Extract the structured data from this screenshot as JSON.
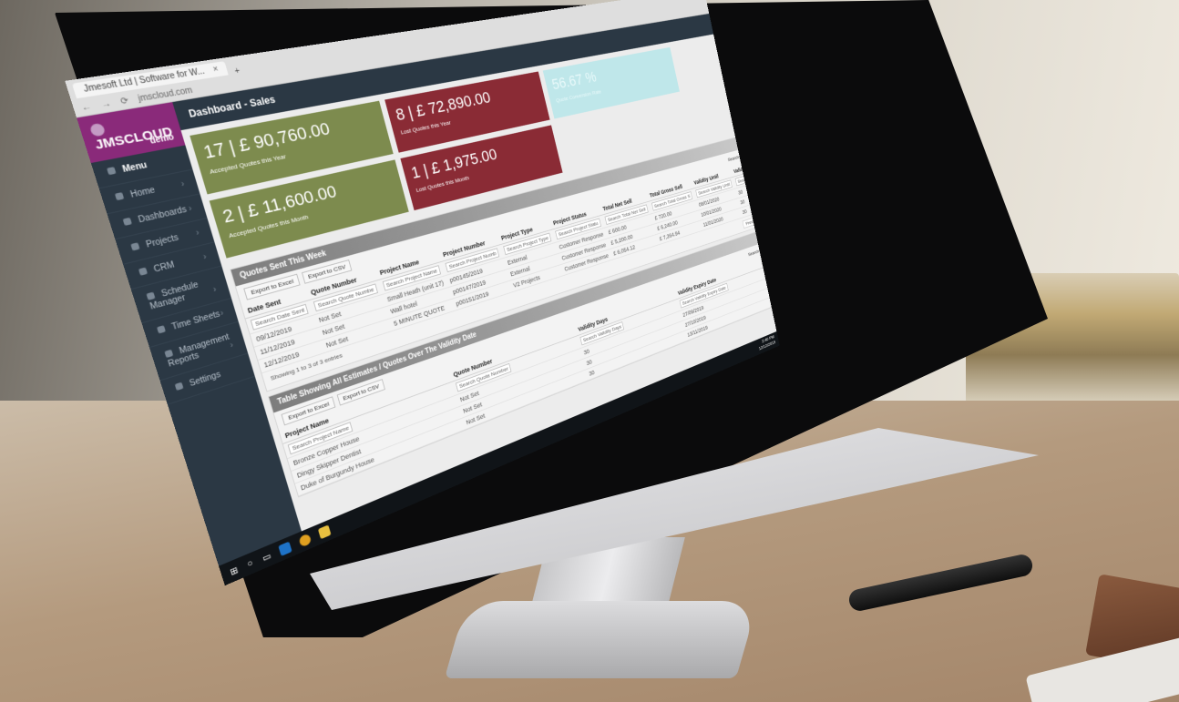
{
  "browser": {
    "tab_title": "Jmesoft Ltd | Software for W...",
    "tab_close": "×",
    "new_tab": "+",
    "url": "jmscloud.com"
  },
  "brand": {
    "name": "JMSCLOUD",
    "tag": "demo"
  },
  "sidebar": {
    "items": [
      {
        "label": "Menu"
      },
      {
        "label": "Home"
      },
      {
        "label": "Dashboards"
      },
      {
        "label": "Projects"
      },
      {
        "label": "CRM"
      },
      {
        "label": "Schedule Manager"
      },
      {
        "label": "Time Sheets"
      },
      {
        "label": "Management Reports"
      },
      {
        "label": "Settings"
      }
    ]
  },
  "header": {
    "title": "Dashboard - Sales"
  },
  "cards": [
    {
      "value": "17 | £ 90,760.00",
      "label": "Accepted Quotes this Year",
      "color": "#7d8b4e"
    },
    {
      "value": "8 | £ 72,890.00",
      "label": "Lost Quotes this Year",
      "color": "#8a2b35"
    },
    {
      "value": "56.67 %",
      "label": "Quote Conversion Rate",
      "color": "#bfe7ea"
    },
    {
      "value": "2 | £ 11,600.00",
      "label": "Accepted Quotes this Month",
      "color": "#7d8b4e"
    },
    {
      "value": "1 | £ 1,975.00",
      "label": "Lost Quotes this Month",
      "color": "#8a2b35"
    }
  ],
  "right_table": {
    "search_label": "Search:",
    "columns": [
      "Total Net Sell",
      "Total Gross Sell",
      "Validity Until",
      "Validity (days)"
    ],
    "search_placeholders": [
      "Search Total Net Sell",
      "Search Total Gross S",
      "Search Validity Until",
      "Search Validity (days"
    ],
    "rows": [
      [
        "£ 600.00",
        "£ 720.00",
        "08/01/2020",
        "30"
      ],
      [
        "£ 5,200.00",
        "£ 6,240.00",
        "10/01/2020",
        "30"
      ],
      [
        "£ 6,054.12",
        "£ 7,264.94",
        "11/01/2020",
        "30"
      ]
    ],
    "pager": {
      "prev": "Previous",
      "page": "1",
      "next": "Next"
    }
  },
  "quotes_sent": {
    "title": "Quotes Sent This Week",
    "export_excel": "Export to Excel",
    "export_csv": "Export to CSV",
    "columns": [
      "Date Sent",
      "Quote Number",
      "Project Name",
      "Project Number",
      "Project Type",
      "Project Status"
    ],
    "search_placeholders": [
      "Search Date Sent",
      "Search Quote Numbe",
      "Search Project Name",
      "Search Project Numb",
      "Search Project Type",
      "Search Project Statu"
    ],
    "rows": [
      [
        "09/12/2019",
        "Not Set",
        "Small Heath (unit 17)",
        "p00145/2019",
        "External",
        "Customer Response"
      ],
      [
        "11/12/2019",
        "Not Set",
        "Wall hotel",
        "p00147/2019",
        "External",
        "Customer Response"
      ],
      [
        "12/12/2019",
        "Not Set",
        "5 MINUTE QUOTE",
        "p00151/2019",
        "V2 Projects",
        "Customer Response"
      ]
    ],
    "footer": "Showing 1 to 3 of 3 entries"
  },
  "validity_table": {
    "title": "Table Showing All Estimates / Quotes Over The Validity Date",
    "export_excel": "Export to Excel",
    "export_csv": "Export to CSV",
    "search_label": "Search:",
    "columns": [
      "Project Name",
      "Quote Number",
      "Validity Days",
      "Validity Expiry Date"
    ],
    "search_placeholders": [
      "Search Project Name",
      "Search Quote Number",
      "Search Validity Days",
      "Search Validity Expiry Date"
    ],
    "rows": [
      [
        "Bronze Copper House",
        "Not Set",
        "30",
        "27/09/2019"
      ],
      [
        "Dingy Skipper Dentist",
        "Not Set",
        "30",
        "27/10/2019"
      ],
      [
        "Duke of Burgundy House",
        "Not Set",
        "30",
        "13/11/2019"
      ]
    ]
  },
  "taskbar": {
    "time": "2:40 PM",
    "date": "12/12/2019"
  }
}
